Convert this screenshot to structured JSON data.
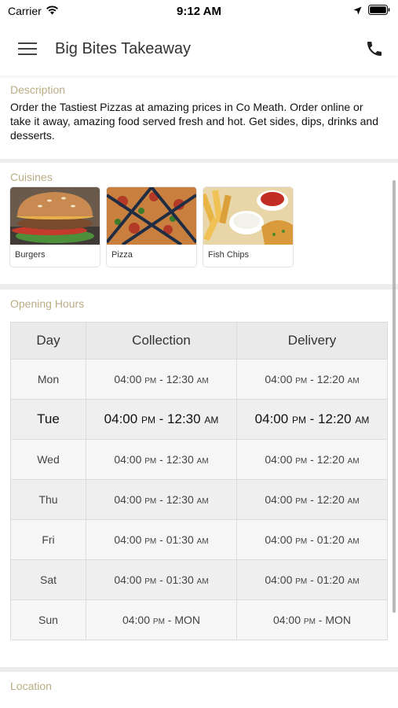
{
  "status_bar": {
    "carrier": "Carrier",
    "time": "9:12 AM"
  },
  "header": {
    "title": "Big Bites Takeaway",
    "menu_icon": "hamburger-menu-icon",
    "call_icon": "phone-icon"
  },
  "description": {
    "title": "Description",
    "text": "Order the Tastiest Pizzas at amazing prices in Co Meath. Order online or take it away, amazing food served fresh and hot. Get sides, dips, drinks and desserts."
  },
  "cuisines": {
    "title": "Cuisines",
    "items": [
      {
        "label": "Burgers"
      },
      {
        "label": "Pizza"
      },
      {
        "label": "Fish  Chips"
      }
    ]
  },
  "opening_hours": {
    "title": "Opening Hours",
    "headers": [
      "Day",
      "Collection",
      "Delivery"
    ],
    "rows": [
      {
        "day": "Mon",
        "collection": {
          "start": "04:00",
          "start_suffix": "PM",
          "sep": " - ",
          "end": "12:30",
          "end_suffix": "AM"
        },
        "delivery": {
          "start": "04:00",
          "start_suffix": "PM",
          "sep": " - ",
          "end": "12:20",
          "end_suffix": "AM"
        }
      },
      {
        "day": "Tue",
        "collection": {
          "start": "04:00",
          "start_suffix": "PM",
          "sep": " - ",
          "end": "12:30",
          "end_suffix": "AM"
        },
        "delivery": {
          "start": "04:00",
          "start_suffix": "PM",
          "sep": " - ",
          "end": "12:20",
          "end_suffix": "AM"
        }
      },
      {
        "day": "Wed",
        "collection": {
          "start": "04:00",
          "start_suffix": "PM",
          "sep": " - ",
          "end": "12:30",
          "end_suffix": "AM"
        },
        "delivery": {
          "start": "04:00",
          "start_suffix": "PM",
          "sep": " - ",
          "end": "12:20",
          "end_suffix": "AM"
        }
      },
      {
        "day": "Thu",
        "collection": {
          "start": "04:00",
          "start_suffix": "PM",
          "sep": " - ",
          "end": "12:30",
          "end_suffix": "AM"
        },
        "delivery": {
          "start": "04:00",
          "start_suffix": "PM",
          "sep": " - ",
          "end": "12:20",
          "end_suffix": "AM"
        }
      },
      {
        "day": "Fri",
        "collection": {
          "start": "04:00",
          "start_suffix": "PM",
          "sep": " - ",
          "end": "01:30",
          "end_suffix": "AM"
        },
        "delivery": {
          "start": "04:00",
          "start_suffix": "PM",
          "sep": " - ",
          "end": "01:20",
          "end_suffix": "AM"
        }
      },
      {
        "day": "Sat",
        "collection": {
          "start": "04:00",
          "start_suffix": "PM",
          "sep": " - ",
          "end": "01:30",
          "end_suffix": "AM"
        },
        "delivery": {
          "start": "04:00",
          "start_suffix": "PM",
          "sep": " - ",
          "end": "01:20",
          "end_suffix": "AM"
        }
      },
      {
        "day": "Sun",
        "collection": {
          "start": "04:00",
          "start_suffix": "PM",
          "sep": " - ",
          "end": "MON",
          "end_suffix": ""
        },
        "delivery": {
          "start": "04:00",
          "start_suffix": "PM",
          "sep": " - ",
          "end": "MON",
          "end_suffix": ""
        }
      }
    ]
  },
  "location": {
    "title": "Location"
  },
  "colors": {
    "section_title": "#b9ad84",
    "table_header_bg": "#eaeaea",
    "page_bg": "#ececec"
  }
}
